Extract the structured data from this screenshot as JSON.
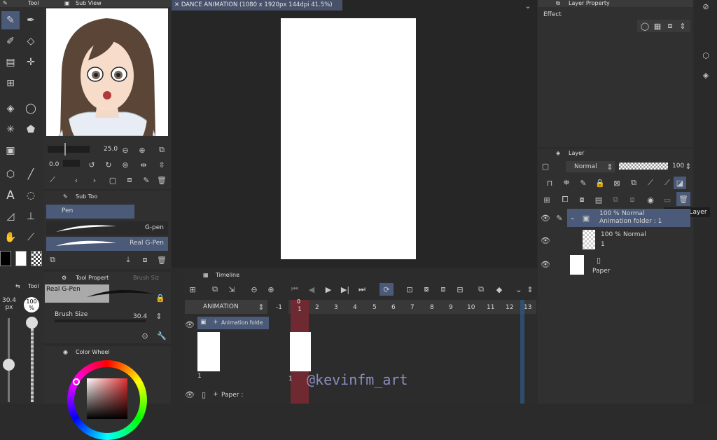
{
  "tool_panel": {
    "title": "Tool"
  },
  "sub_view": {
    "title": "Sub View"
  },
  "canvas": {
    "tab_title": "DANCE ANIMATION (1080 x 1920px 144dpi 41.5%)"
  },
  "layer_property": {
    "title": "Layer Property",
    "effect_label": "Effect"
  },
  "subview_controls": {
    "zoom_value": "25.0",
    "rotate_value": "0.0"
  },
  "sub_tool": {
    "title": "Sub Too",
    "group": "Pen",
    "brushes": [
      {
        "label": "G-pen"
      },
      {
        "label": "Real G-Pen"
      }
    ]
  },
  "tool_property": {
    "title": "Tool Propert",
    "tab2": "Brush Siz",
    "brush_name": "Real G-Pen",
    "brush_size_label": "Brush Size",
    "brush_size_value": "30.4"
  },
  "left_mini": {
    "tool_label": "Tool",
    "size_value": "30.4",
    "size_unit": "px",
    "opacity_value": "100",
    "opacity_unit": "%"
  },
  "color_wheel": {
    "title": "Color Wheel"
  },
  "timeline": {
    "title": "Timeline",
    "track_name": "ANIMATION",
    "frame_numbers": [
      "-1",
      "1",
      "2",
      "3",
      "4",
      "5",
      "6",
      "7",
      "8",
      "9",
      "10",
      "11",
      "12",
      "13"
    ],
    "current_frame_marker": "0",
    "folder_row_label": "Animation folde",
    "cel_label": "1",
    "cel_frame_label": "1",
    "paper_row_label": "Paper :"
  },
  "layer_panel": {
    "title": "Layer",
    "blend_mode": "Normal",
    "opacity": "100",
    "tooltip": "Delete Layer",
    "layers": [
      {
        "percent": "100 %",
        "mode": "Normal",
        "name": "Animation folder : 1"
      },
      {
        "percent": "100 %",
        "mode": "Normal",
        "name": "1"
      },
      {
        "name": "Paper"
      }
    ]
  },
  "watermark": "@kevinfm_art",
  "colors": {
    "accent": "#4a5a78",
    "playhead": "#c0303a",
    "bg": "#2b2b2b",
    "panel": "#323232"
  }
}
